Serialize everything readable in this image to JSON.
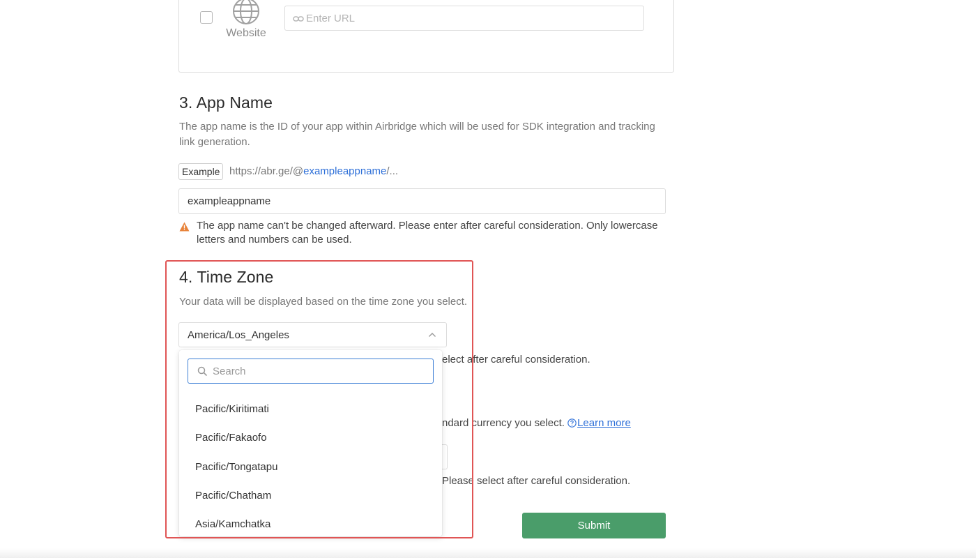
{
  "platform": {
    "website_label": "Website",
    "url_placeholder": "Enter URL",
    "icons": {
      "globe": "globe-icon",
      "link": "link-icon"
    }
  },
  "app_name": {
    "heading": "3. App Name",
    "description": "The app name is the ID of your app within Airbridge which will be used for SDK integration and tracking link generation.",
    "example_tag": "Example",
    "example_url_prefix": "https://abr.ge/@",
    "example_url_highlight": "exampleappname",
    "example_url_suffix": "/...",
    "input_value": "exampleappname",
    "warning": "The app name can't be changed afterward. Please enter after careful consideration. Only lowercase letters and numbers can be used.",
    "warning_color": "#e8833a"
  },
  "time_zone": {
    "heading": "4. Time Zone",
    "description": "Your data will be displayed based on the time zone you select.",
    "selected": "America/Los_Angeles",
    "search_placeholder": "Search",
    "options": [
      "Pacific/Kiritimati",
      "Pacific/Fakaofo",
      "Pacific/Tongatapu",
      "Pacific/Chatham",
      "Asia/Kamchatka"
    ]
  },
  "background": {
    "tz_warning_partial": "elect after careful consideration.",
    "currency_desc_partial": "ndard currency you select.",
    "learn_more": "Learn more",
    "currency_warning_partial": "Please select after careful consideration."
  },
  "submit_label": "Submit",
  "colors": {
    "accent_blue": "#2d6fd8",
    "submit_green": "#4a9d6a",
    "highlight_red": "#e05555"
  }
}
